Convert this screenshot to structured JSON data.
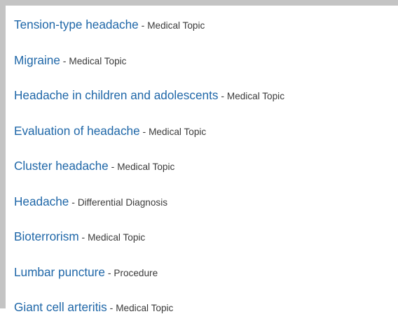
{
  "results": [
    {
      "title": "Tension-type headache",
      "separator": " - ",
      "type": "Medical Topic"
    },
    {
      "title": "Migraine",
      "separator": " - ",
      "type": "Medical Topic"
    },
    {
      "title": "Headache in children and adolescents",
      "separator": " - ",
      "type": "Medical Topic"
    },
    {
      "title": "Evaluation of headache",
      "separator": " - ",
      "type": "Medical Topic"
    },
    {
      "title": "Cluster headache",
      "separator": " - ",
      "type": "Medical Topic"
    },
    {
      "title": "Headache",
      "separator": " - ",
      "type": "Differential Diagnosis"
    },
    {
      "title": "Bioterrorism",
      "separator": " - ",
      "type": "Medical Topic"
    },
    {
      "title": "Lumbar puncture",
      "separator": " - ",
      "type": "Procedure"
    },
    {
      "title": "Giant cell arteritis",
      "separator": " - ",
      "type": "Medical Topic"
    }
  ],
  "colors": {
    "link": "#1f67a8",
    "type_text": "#3a3a3a",
    "frame_border": "#c4c4c4",
    "background": "#ffffff"
  }
}
